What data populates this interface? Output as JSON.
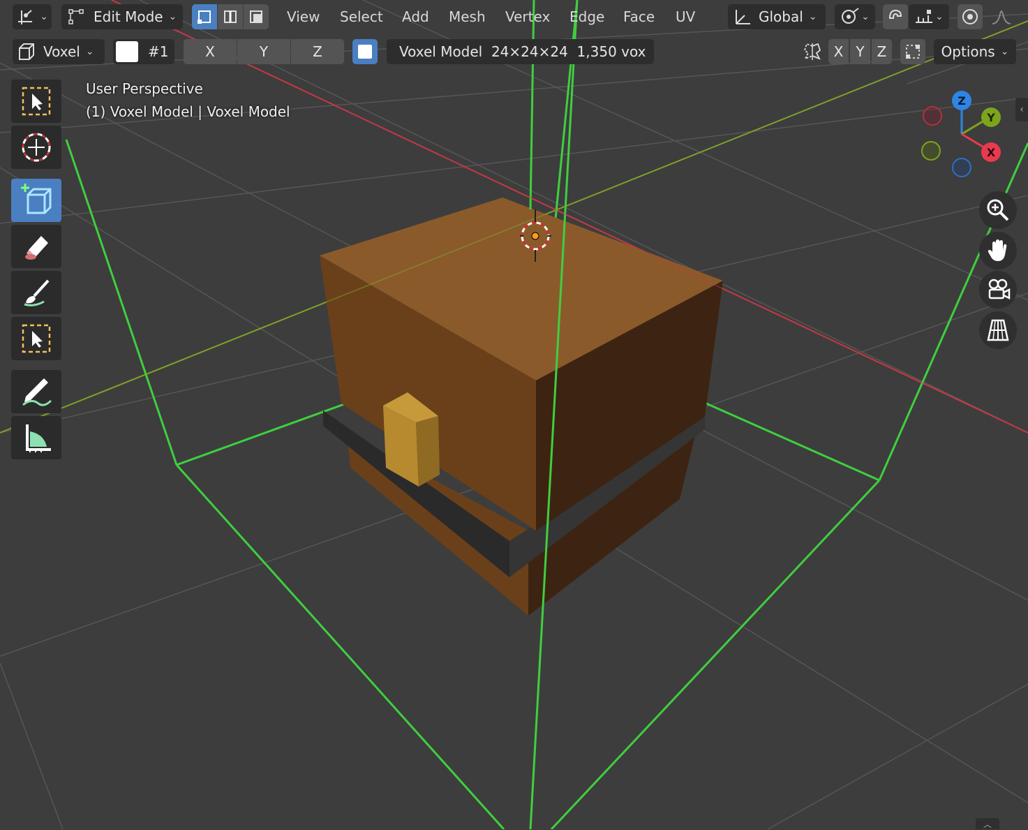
{
  "header": {
    "mode": "Edit Mode",
    "menu": [
      "View",
      "Select",
      "Add",
      "Mesh",
      "Vertex",
      "Edge",
      "Face",
      "UV"
    ],
    "transform_orientation": "Global"
  },
  "tool_settings": {
    "brush_type": "Voxel",
    "color_index": "#1",
    "mirror_x": "X",
    "mirror_y": "Y",
    "mirror_z": "Z",
    "model_info": "Voxel Model  24×24×24  1,350 vox",
    "axis_x": "X",
    "axis_y": "Y",
    "axis_z": "Z",
    "options_label": "Options"
  },
  "viewport": {
    "view_name": "User Perspective",
    "object_info": "(1) Voxel Model | Voxel Model"
  },
  "gizmo": {
    "z_label": "Z",
    "y_label": "Y",
    "x_label": "X",
    "colors": {
      "x": "#e83a4e",
      "y": "#7da51b",
      "z": "#2f85e6"
    }
  },
  "colors": {
    "accent": "#4a7fc1",
    "swatch": "#ffffff",
    "bounds": "#3fcf3f",
    "chest_top": "#8b5a2b",
    "chest_front": "#6a401a",
    "chest_side": "#3d2412",
    "band": "#2f2f2f",
    "latch": "#b78a2f"
  }
}
